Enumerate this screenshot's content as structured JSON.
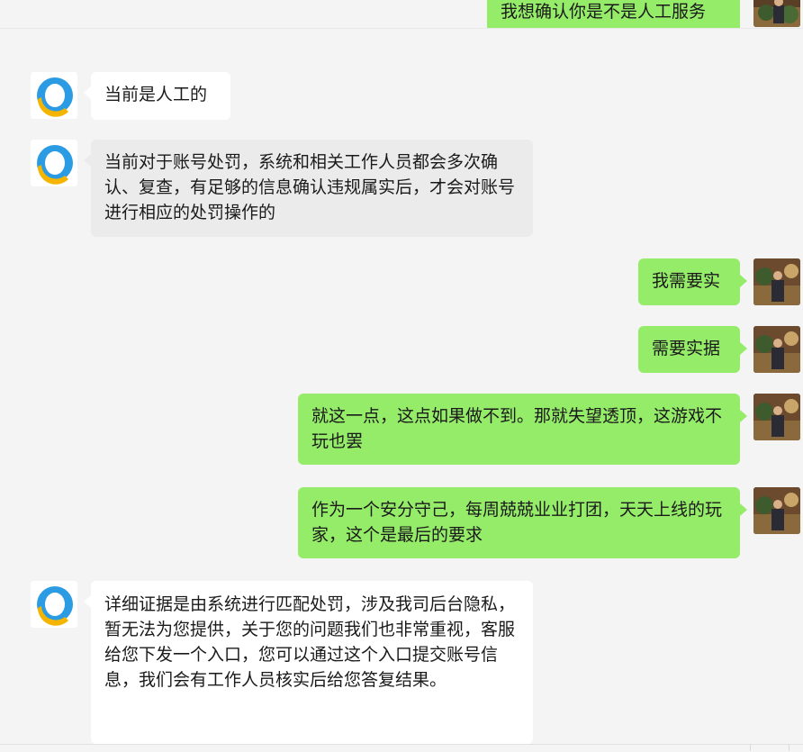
{
  "messages": [
    {
      "id": "m0",
      "side": "right",
      "text": "我想确认你是不是人工服务"
    },
    {
      "id": "m1",
      "side": "left",
      "text": "当前是人工的"
    },
    {
      "id": "m2",
      "side": "left",
      "text": "当前对于账号处罚，系统和相关工作人员都会多次确认、复查，有足够的信息确认违规属实后，才会对账号进行相应的处罚操作的"
    },
    {
      "id": "m3",
      "side": "right",
      "text": "我需要实"
    },
    {
      "id": "m4",
      "side": "right",
      "text": "需要实据"
    },
    {
      "id": "m5",
      "side": "right",
      "text": "就这一点，这点如果做不到。那就失望透顶，这游戏不玩也罢"
    },
    {
      "id": "m6",
      "side": "right",
      "text": "作为一个安分守己，每周兢兢业业打团，天天上线的玩家，这个是最后的要求"
    },
    {
      "id": "m7",
      "side": "left",
      "text": "详细证据是由系统进行匹配处罚，涉及我司后台隐私，暂无法为您提供，关于您的问题我们也非常重视，客服给您下发一个入口，您可以通过这个入口提交账号信息，我们会有工作人员核实后给您答复结果。"
    }
  ],
  "icons": {
    "bot_avatar": "qq-penguin-icon",
    "user_avatar": "user-photo-avatar"
  },
  "colors": {
    "background": "#f4f4f4",
    "bubble_self": "#95ec69",
    "bubble_other": "#ffffff",
    "bubble_other_hover": "#ebebeb"
  }
}
